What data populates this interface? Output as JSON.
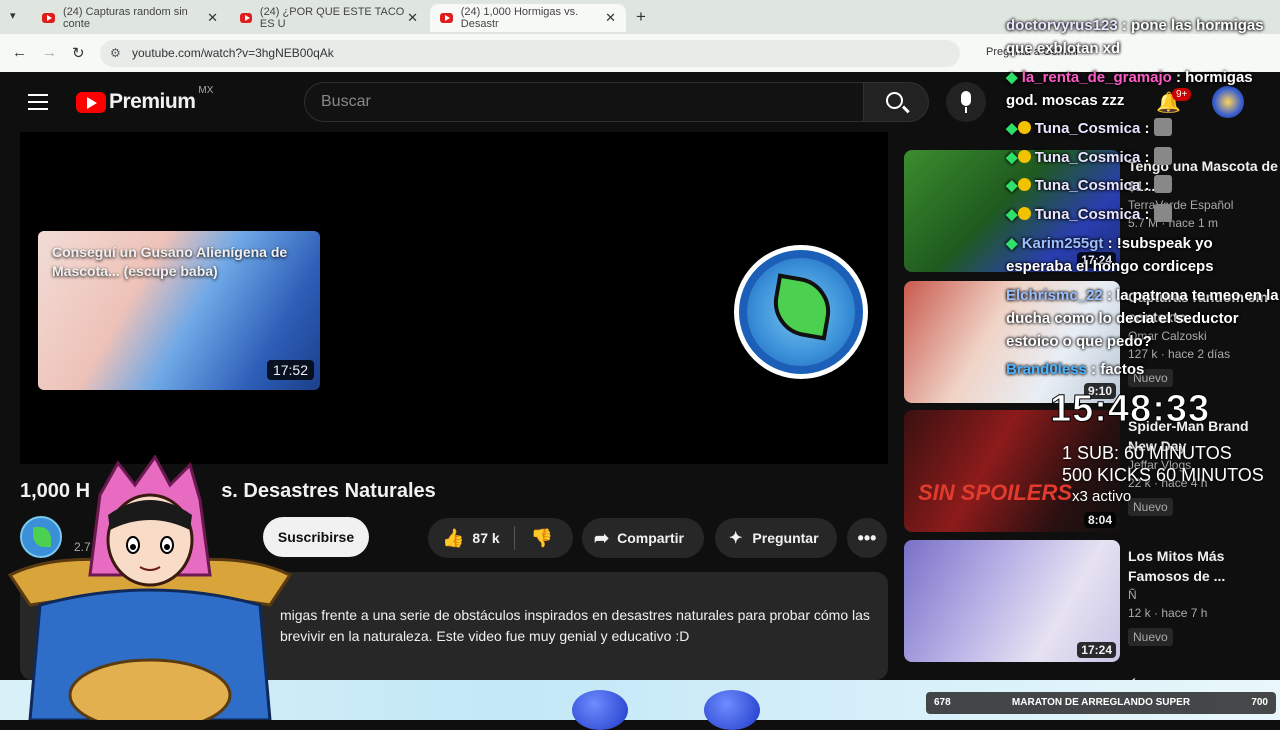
{
  "browser": {
    "tabs": [
      {
        "label": "(24) Capturas random sin conte"
      },
      {
        "label": "(24) ¿POR QUE ESTE TACO ES U"
      },
      {
        "label": "(24) 1,000 Hormigas vs. Desastr"
      }
    ],
    "url": "youtube.com/watch?v=3hgNEB00qAk",
    "gemini_label": "Pregunta a Gemini"
  },
  "youtube": {
    "logo_text": "Premium",
    "region": "MX",
    "search_placeholder": "Buscar",
    "notification_count": "9+"
  },
  "player": {
    "endcard_title": "Conseguí un Gusano Alienígena de Mascota... (escupe baba)",
    "endcard_duration": "17:52"
  },
  "video": {
    "title_visible_start": "1,000 H",
    "title_visible_end": "s. Desastres Naturales",
    "subs": "2.7",
    "subscribe_label": "Suscribirse",
    "likes": "87 k",
    "share_label": "Compartir",
    "ask_label": "Preguntar",
    "description_line1": "migas frente a una serie de obstáculos inspirados en desastres naturales para probar cómo las",
    "description_line2": "brevivir en la naturaleza. Este video fue muy genial y educativo :D"
  },
  "recommendations": [
    {
      "title": "Tengo una Mascota de $1...",
      "channel": "TerraVerde Español",
      "meta": "5.7 M · hace 1 m",
      "duration": "17:24",
      "badge": ""
    },
    {
      "title": "Capturas random sin contexto",
      "channel": "Omar Calzoski",
      "meta": "127 k · hace 2 días",
      "duration": "9:10",
      "badge": "Nuevo"
    },
    {
      "title": "Spider-Man Brand New Day",
      "channel": "Jeffar Vlogs",
      "meta": "22 k · hace 4 h",
      "duration": "8:04",
      "badge": "Nuevo"
    },
    {
      "title": "Los Mitos Más Famosos de ...",
      "channel": "Ñ",
      "meta": "12 k · hace 7 h",
      "duration": "17:24",
      "badge": "Nuevo"
    },
    {
      "title": "Último en Salir de",
      "channel": "",
      "meta": "",
      "duration": "",
      "badge": ""
    }
  ],
  "chat": [
    {
      "user": "doctorvyrus123",
      "text": ": pone las hormigas que exblotan xd"
    },
    {
      "user": "la_renta_de_gramajo",
      "text": ": hormigas god. moscas zzz"
    },
    {
      "user": "Tuna_Cosmica",
      "text": ":"
    },
    {
      "user": "Tuna_Cosmica",
      "text": ":"
    },
    {
      "user": "Tuna_Cosmica",
      "text": ":"
    },
    {
      "user": "Tuna_Cosmica",
      "text": ":"
    },
    {
      "user": "Karim255gt",
      "text": ": !subspeak yo esperaba el hongo cordiceps"
    },
    {
      "user": "Elchrismc_22",
      "text": ": la patrona te meo en la ducha como lo decia el seductor estoico o que pedo?"
    },
    {
      "user": "Brand0less",
      "text": ": factos"
    }
  ],
  "stream": {
    "clock": "15:48:33",
    "timer1": "1 SUB: 60 MINUTOS",
    "timer2": "500 KICKS 60 MINUTOS",
    "timer3": "x3 activo",
    "progress_left": "678",
    "progress_label": "MARATON DE ARREGLANDO SUPER",
    "progress_right": "700"
  }
}
